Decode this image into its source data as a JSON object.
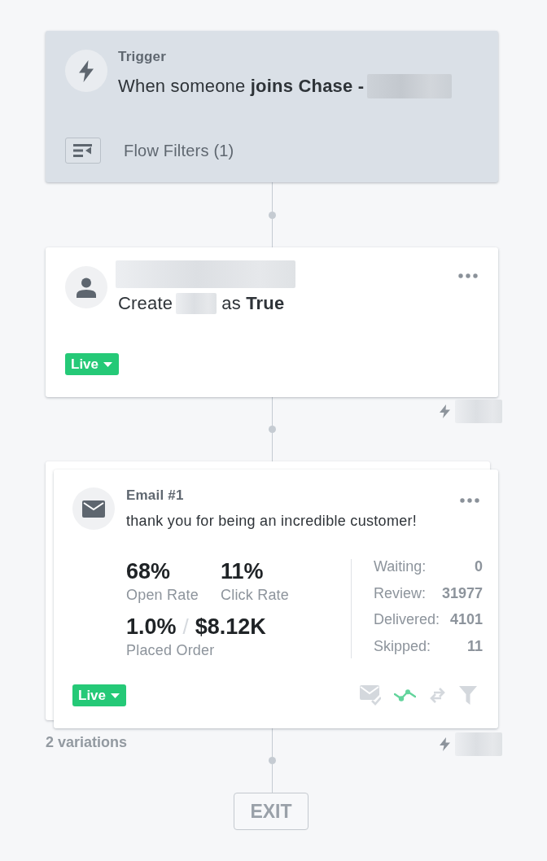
{
  "trigger": {
    "label": "Trigger",
    "title": "When someone **joins Chase -**",
    "filter_label": "Flow Filters (1)"
  },
  "update_step": {
    "action_start": "Create",
    "action_end": "as **True**",
    "status": "Live"
  },
  "email_step": {
    "title": "Email #1",
    "subject": "thank you for being an incredible customer!",
    "rates": [
      {
        "value": "68%",
        "label": "Open Rate"
      },
      {
        "value": "11%",
        "label": "Click Rate"
      }
    ],
    "placed_order": {
      "rate": "1.0%",
      "separator": "/",
      "revenue": "$8.12K",
      "label": "Placed Order"
    },
    "counts": [
      {
        "label": "Waiting:",
        "value": "0"
      },
      {
        "label": "Review:",
        "value": "31977"
      },
      {
        "label": "Delivered:",
        "value": "4101"
      },
      {
        "label": "Skipped:",
        "value": "11"
      }
    ],
    "status": "Live",
    "actions": [
      {
        "active": false
      },
      {
        "active": true
      },
      {
        "active": false
      },
      {
        "active": false
      }
    ],
    "variations": "2 variations"
  },
  "exit": {
    "label": "EXIT"
  }
}
